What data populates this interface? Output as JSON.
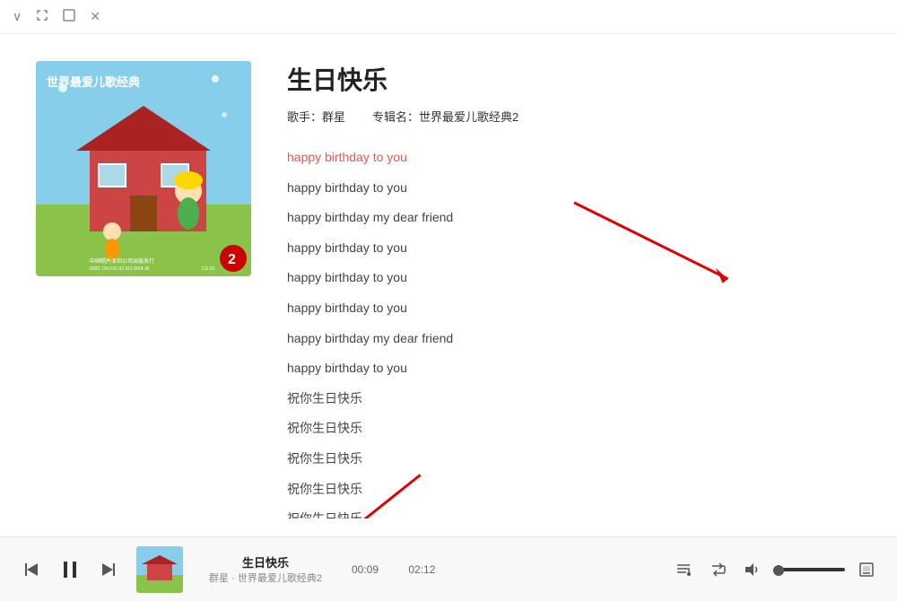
{
  "titlebar": {
    "btn_minimize": "∨",
    "btn_expand": "⤢",
    "btn_fullscreen": "□",
    "btn_close": "✕"
  },
  "song": {
    "title": "生日快乐",
    "artist_label": "歌手：",
    "artist": "群星",
    "album_label": "专辑名：",
    "album": "世界最爱儿歌经典2"
  },
  "lyrics": [
    {
      "text": "happy birthday to you",
      "active": true
    },
    {
      "text": "happy birthday to you",
      "active": false
    },
    {
      "text": "happy birthday my dear friend",
      "active": false
    },
    {
      "text": "happy birthday to you",
      "active": false
    },
    {
      "text": "happy birthday to you",
      "active": false
    },
    {
      "text": "happy birthday to you",
      "active": false
    },
    {
      "text": "happy birthday my dear friend",
      "active": false
    },
    {
      "text": "happy birthday to you",
      "active": false
    },
    {
      "text": "祝你生日快乐",
      "active": false
    },
    {
      "text": "祝你生日快乐",
      "active": false
    },
    {
      "text": "祝你生日快乐",
      "active": false
    },
    {
      "text": "祝你生日快乐",
      "active": false
    },
    {
      "text": "祝你生日快乐",
      "active": false
    }
  ],
  "player": {
    "song_title": "生日快乐",
    "artist_album": "群星 · 世界最爱儿歌经典2",
    "current_time": "00:09",
    "total_time": "02:12",
    "volume_icon": "🔊"
  }
}
